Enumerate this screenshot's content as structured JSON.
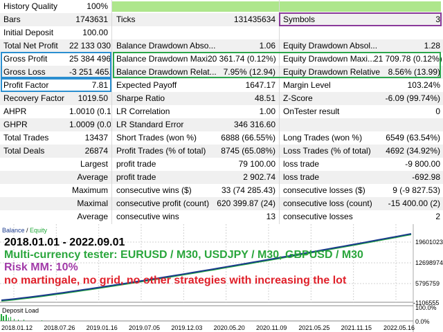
{
  "history_quality": {
    "label": "History Quality",
    "value": "100%",
    "fill_fraction": 1.0
  },
  "rows": [
    [
      {
        "t": "Bars"
      },
      {
        "t": "1743631"
      },
      {
        "t": "Ticks"
      },
      {
        "t": "131435634"
      },
      {
        "t": "Symbols"
      },
      {
        "t": "3"
      }
    ],
    [
      {
        "t": "Initial Deposit"
      },
      {
        "t": "100.00"
      },
      {
        "t": ""
      },
      {
        "t": ""
      },
      {
        "t": ""
      },
      {
        "t": ""
      }
    ],
    [
      {
        "t": "Total Net Profit"
      },
      {
        "t": "22 133 030.83"
      },
      {
        "t": "Balance Drawdown Abso..."
      },
      {
        "t": "1.06"
      },
      {
        "t": "Equity Drawdown Absol..."
      },
      {
        "t": "1.28"
      }
    ],
    [
      {
        "t": "Gross Profit"
      },
      {
        "t": "25 384 496.01"
      },
      {
        "t": "Balance Drawdown Maxi..."
      },
      {
        "t": "20 361.74 (0.12%)"
      },
      {
        "t": "Equity Drawdown Maxi..."
      },
      {
        "t": "21 709.78 (0.12%)"
      }
    ],
    [
      {
        "t": "Gross Loss"
      },
      {
        "t": "-3 251 465.18"
      },
      {
        "t": "Balance Drawdown Relat..."
      },
      {
        "t": "7.95% (12.94)"
      },
      {
        "t": "Equity Drawdown Relative"
      },
      {
        "t": "8.56% (13.99)"
      }
    ],
    [
      {
        "t": "Profit Factor"
      },
      {
        "t": "7.81"
      },
      {
        "t": "Expected Payoff"
      },
      {
        "t": "1647.17"
      },
      {
        "t": "Margin Level"
      },
      {
        "t": "103.24%"
      }
    ],
    [
      {
        "t": "Recovery Factor"
      },
      {
        "t": "1019.50"
      },
      {
        "t": "Sharpe Ratio"
      },
      {
        "t": "48.51"
      },
      {
        "t": "Z-Score"
      },
      {
        "t": "-6.09 (99.74%)"
      }
    ],
    [
      {
        "t": "AHPR"
      },
      {
        "t": "1.0010 (0.10%)"
      },
      {
        "t": "LR Correlation"
      },
      {
        "t": "1.00"
      },
      {
        "t": "OnTester result"
      },
      {
        "t": "0"
      }
    ],
    [
      {
        "t": "GHPR"
      },
      {
        "t": "1.0009 (0.09%)"
      },
      {
        "t": "LR Standard Error"
      },
      {
        "t": "346 316.60"
      },
      {
        "t": ""
      },
      {
        "t": ""
      }
    ],
    [
      {
        "t": "Total Trades"
      },
      {
        "t": "13437"
      },
      {
        "t": "Short Trades (won %)"
      },
      {
        "t": "6888 (66.55%)"
      },
      {
        "t": "Long Trades (won %)"
      },
      {
        "t": "6549 (63.54%)"
      }
    ],
    [
      {
        "t": "Total Deals"
      },
      {
        "t": "26874"
      },
      {
        "t": "Profit Trades (% of total)"
      },
      {
        "t": "8745 (65.08%)"
      },
      {
        "t": "Loss Trades (% of total)"
      },
      {
        "t": "4692 (34.92%)"
      }
    ],
    [
      {
        "t": "Largest"
      },
      {
        "t": ""
      },
      {
        "t": "profit trade"
      },
      {
        "t": "79 100.00"
      },
      {
        "t": "loss trade"
      },
      {
        "t": "-9 800.00"
      }
    ],
    [
      {
        "t": "Average"
      },
      {
        "t": ""
      },
      {
        "t": "profit trade"
      },
      {
        "t": "2 902.74"
      },
      {
        "t": "loss trade"
      },
      {
        "t": "-692.98"
      }
    ],
    [
      {
        "t": "Maximum"
      },
      {
        "t": ""
      },
      {
        "t": "consecutive wins ($)"
      },
      {
        "t": "33 (74 285.43)"
      },
      {
        "t": "consecutive losses ($)"
      },
      {
        "t": "9 (-9 827.53)"
      }
    ],
    [
      {
        "t": "Maximal"
      },
      {
        "t": ""
      },
      {
        "t": "consecutive profit (count)"
      },
      {
        "t": "620 399.87 (24)"
      },
      {
        "t": "consecutive loss (count)"
      },
      {
        "t": "-15 400.00 (2)"
      }
    ],
    [
      {
        "t": "Average"
      },
      {
        "t": ""
      },
      {
        "t": "consecutive wins"
      },
      {
        "t": "13"
      },
      {
        "t": "consecutive losses"
      },
      {
        "t": "2"
      }
    ]
  ],
  "chart": {
    "legend_balance": "Balance",
    "legend_sep": " / ",
    "legend_equity": "Equity",
    "y_ticks": [
      "19601023",
      "12698974",
      "5795759",
      "-1106555"
    ],
    "x_ticks": [
      "2018.01.12",
      "2018.07.26",
      "2019.01.16",
      "2019.07.05",
      "2019.12.03",
      "2020.05.20",
      "2020.11.09",
      "2021.05.25",
      "2021.11.15",
      "2022.05.16"
    ],
    "deposit_load_label": "Deposit Load",
    "deposit_ticks": [
      "100.0%",
      "0.0%"
    ],
    "overlay_line1": "2018.01.01 - 2022.09.01",
    "overlay_line2": "Multi-currency tester: EURUSD / M30, USDJPY / M30, GBPUSD / M30",
    "overlay_line3": "Risk MM: 10%",
    "overlay_line4": "no martingale, no grid, no other strategies with increasing the lot",
    "colors": {
      "balance": "#1a3a8c",
      "equity": "#22a83a",
      "line1": "#000000",
      "line2": "#2aa63c",
      "line3": "#a13aa8",
      "line4": "#e0202a"
    }
  }
}
